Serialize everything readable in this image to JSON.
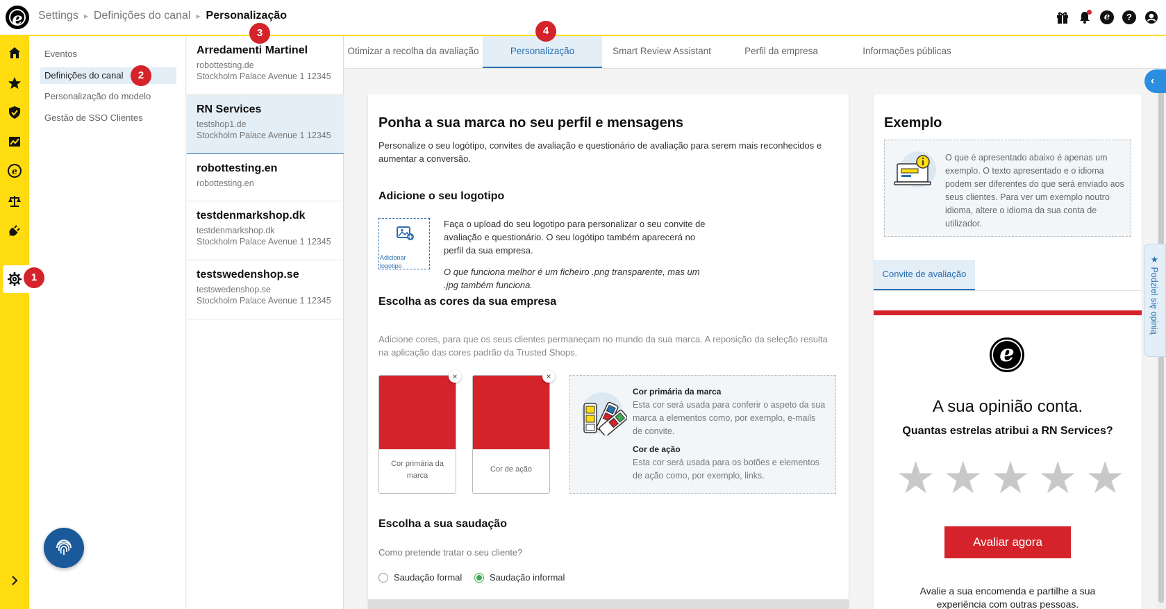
{
  "breadcrumb": {
    "root": "Settings",
    "middle": "Definições do canal",
    "current": "Personalização"
  },
  "top_icons": [
    "gift-icon",
    "bell-icon",
    "etrusted-icon",
    "help-icon",
    "account-icon"
  ],
  "rail_icons": [
    "home-icon",
    "star-icon",
    "shield-icon",
    "chart-icon",
    "etrusted-icon",
    "scales-icon",
    "plug-icon",
    "gear-icon",
    "chevron-right-icon"
  ],
  "steps": {
    "s1": "1",
    "s2": "2",
    "s3": "3",
    "s4": "4"
  },
  "submenu": {
    "items": [
      {
        "label": "Eventos"
      },
      {
        "label": "Definições do canal"
      },
      {
        "label": "Personalização do modelo"
      },
      {
        "label": "Gestão de SSO Clientes"
      }
    ]
  },
  "shops": [
    {
      "name": "Arredamenti Martinel",
      "domain": "robottesting.de",
      "address": "Stockholm Palace Avenue 1 12345"
    },
    {
      "name": "RN Services",
      "domain": "testshop1.de",
      "address": "Stockholm Palace Avenue 1 12345"
    },
    {
      "name": "robottesting.en",
      "domain": "robottesting.en",
      "address": ""
    },
    {
      "name": "testdenmarkshop.dk",
      "domain": "testdenmarkshop.dk",
      "address": "Stockholm Palace Avenue 1 12345"
    },
    {
      "name": "testswedenshop.se",
      "domain": "testswedenshop.se",
      "address": "Stockholm Palace Avenue 1 12345"
    }
  ],
  "tabs": [
    {
      "label": "Otimizar a recolha da avaliação"
    },
    {
      "label": "Personalização"
    },
    {
      "label": "Smart Review Assistant"
    },
    {
      "label": "Perfil da empresa"
    },
    {
      "label": "Informações públicas"
    }
  ],
  "main": {
    "title": "Ponha a sua marca no seu perfil e mensagens",
    "intro": "Personalize o seu logótipo, convites de avaliação e questionário de avaliação para serem mais reconhecidos e aumentar a conversão.",
    "logo_section": {
      "title": "Adicione o seu logotipo",
      "upload_label": "Adicionar logotipo",
      "text": "Faça o upload do seu logotipo para personalizar o seu convite de avaliação e questionário. O seu logótipo também aparecerá no perfil da sua empresa.",
      "hint": "O que funciona melhor é um ficheiro .png transparente, mas um .jpg também funciona."
    },
    "colors_section": {
      "title": "Escolha as cores da sua empresa",
      "desc": "Adicione cores, para que os seus clientes permaneçam no mundo da sua marca. A reposição da seleção resulta na aplicação das cores padrão da Trusted Shops.",
      "primary_label": "Cor primária da marca",
      "action_label": "Cor de ação",
      "primary_color": "#d4232a",
      "action_color": "#d4232a",
      "remove": "×",
      "info_primary_title": "Cor primária da marca",
      "info_primary_desc": "Esta cor será usada para conferir o aspeto da sua marca a elementos como, por exemplo, e-mails de convite.",
      "info_action_title": "Cor de ação",
      "info_action_desc": "Esta cor será usada para os botões e elementos de ação como, por exemplo, links."
    },
    "greeting_section": {
      "title": "Escolha a sua saudação",
      "question": "Como pretende tratar o seu cliente?",
      "formal": "Saudação formal",
      "informal": "Saudação informal",
      "selected": "informal"
    }
  },
  "example": {
    "title": "Exemplo",
    "note": "O que é apresentado abaixo é apenas um exemplo. O texto apresentado e o idioma podem ser diferentes do que será enviado aos seus clientes. Para ver um exemplo noutro idioma, altere o idioma da sua conta de utilizador.",
    "tab": "Convite de avaliação",
    "headline": "A sua opinião conta.",
    "question": "Quantas estrelas atribui a RN Services?",
    "stars": 5,
    "button": "Avaliar agora",
    "footer": "Avalie a sua encomenda e partilhe a sua experiência com outras pessoas."
  },
  "feedback_tab": "★ Podziel się opinią",
  "colors": {
    "accent": "#2b6fb0",
    "brand_yellow": "#ffdc0f",
    "red": "#d4232a"
  }
}
